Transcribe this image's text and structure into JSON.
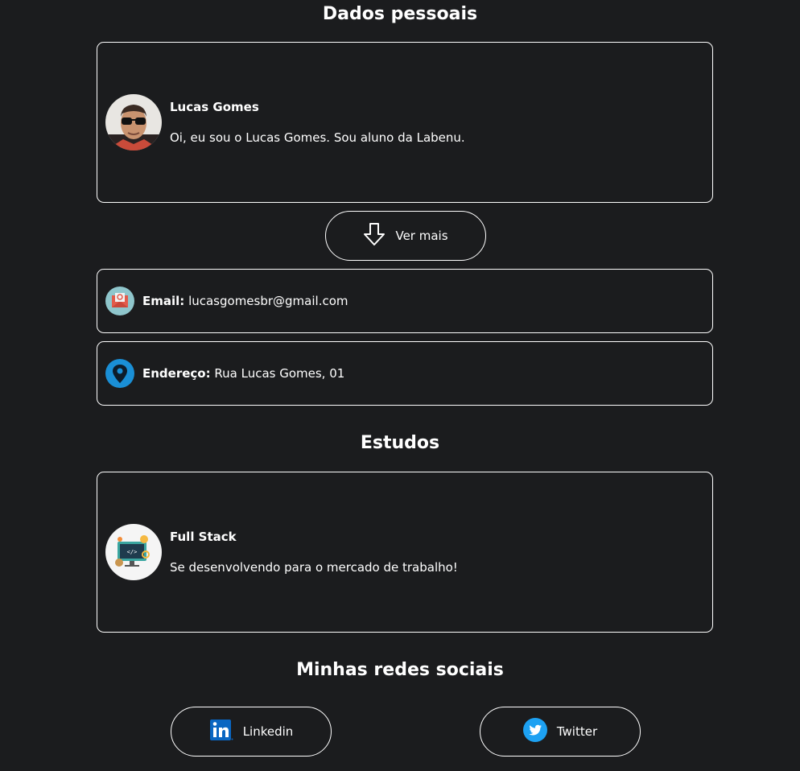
{
  "personal": {
    "title": "Dados pessoais",
    "name": "Lucas Gomes",
    "description": "Oi, eu sou o Lucas Gomes. Sou aluno da Labenu.",
    "more_button": "Ver mais",
    "email_label": "Email:",
    "email_value": "lucasgomesbr@gmail.com",
    "address_label": "Endereço:",
    "address_value": "Rua Lucas Gomes, 01"
  },
  "studies": {
    "title": "Estudos",
    "course": "Full Stack",
    "description": "Se desenvolvendo para o mercado de trabalho!"
  },
  "social": {
    "title": "Minhas redes sociais",
    "linkedin": "Linkedin",
    "twitter": "Twitter"
  },
  "colors": {
    "background": "#1b1c1e",
    "linkedin": "#0a66c2",
    "twitter": "#1da1f2",
    "location": "#1a8fd6"
  },
  "icons": {
    "more": "arrow-down-icon",
    "email": "envelope-icon",
    "address": "location-pin-icon",
    "linkedin": "linkedin-icon",
    "twitter": "twitter-bird-icon"
  }
}
